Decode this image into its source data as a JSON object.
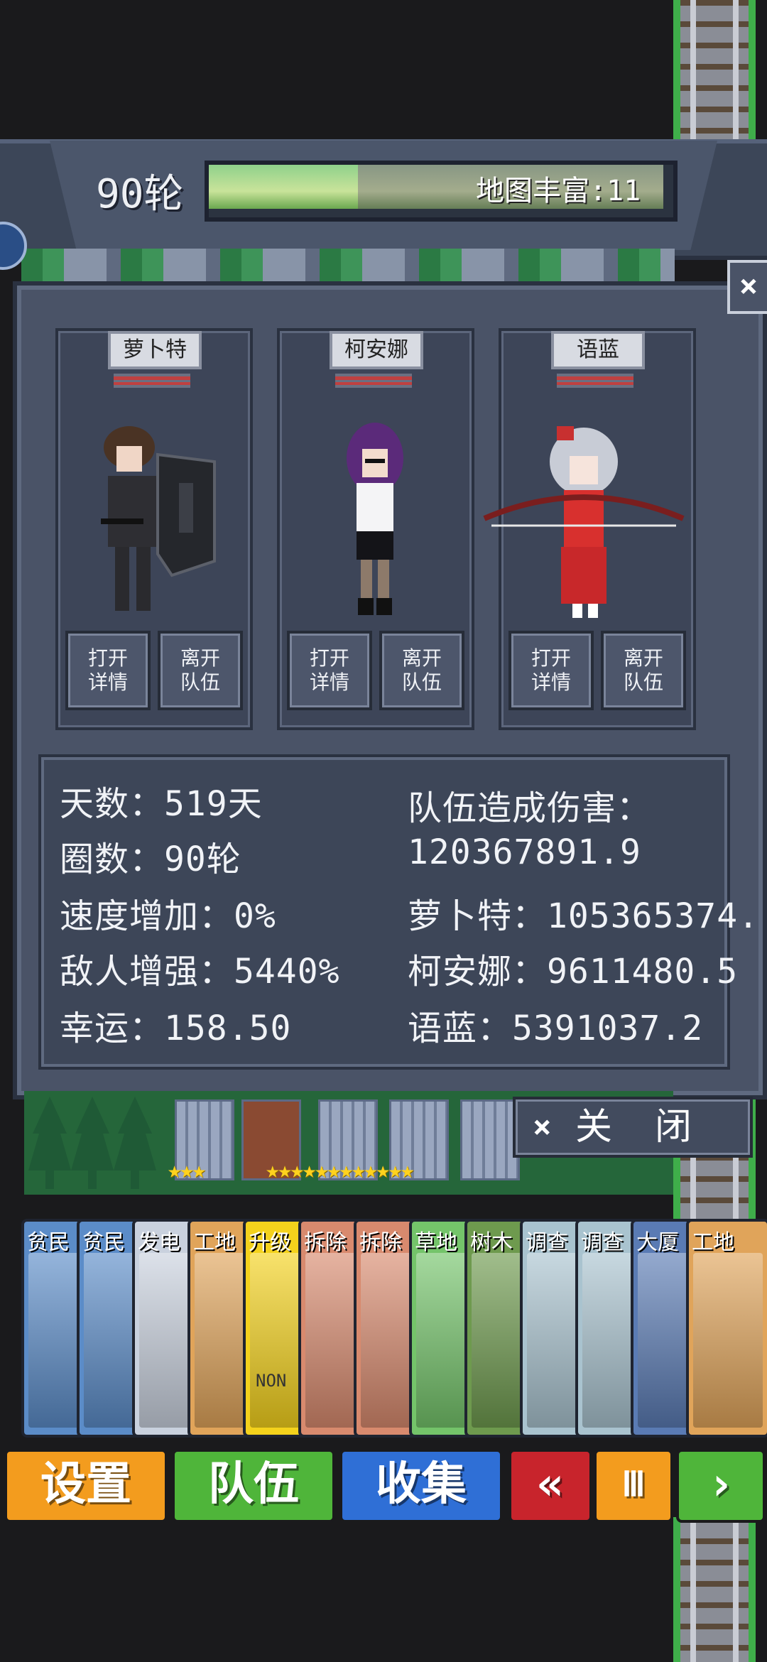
{
  "header": {
    "round": "90轮",
    "map_label": "地图丰富:11"
  },
  "team": [
    {
      "name": "萝卜特",
      "detail": "打开\n详情",
      "leave": "离开\n队伍"
    },
    {
      "name": "柯安娜",
      "detail": "打开\n详情",
      "leave": "离开\n队伍"
    },
    {
      "name": "语蓝",
      "detail": "打开\n详情",
      "leave": "离开\n队伍"
    }
  ],
  "stats": {
    "days": "天数：519天",
    "laps": "圈数：90轮",
    "speed": "速度增加：0%",
    "enemy": "敌人增强：5440%",
    "luck": "幸运：158.50",
    "damage_label": "队伍造成伤害：",
    "damage_total": "120367891.9",
    "dmg_1": "萝卜特：105365374.",
    "dmg_2": "柯安娜：9611480.5",
    "dmg_3": "语蓝：5391037.2"
  },
  "close_button": {
    "x": "×",
    "label": "关闭"
  },
  "cards": [
    {
      "label": "贫民",
      "color": "#5b8cc8"
    },
    {
      "label": "贫民",
      "color": "#5b8cc8"
    },
    {
      "label": "发电",
      "color": "#c9d1de"
    },
    {
      "label": "工地",
      "color": "#e0a45a"
    },
    {
      "label": "升级",
      "color": "#f4d21c"
    },
    {
      "label": "拆除",
      "color": "#d88a6e"
    },
    {
      "label": "拆除",
      "color": "#d88a6e"
    },
    {
      "label": "草地",
      "color": "#74c46a"
    },
    {
      "label": "树木",
      "color": "#6e9a4e"
    },
    {
      "label": "调查",
      "color": "#a9c3cf"
    },
    {
      "label": "调查",
      "color": "#a9c3cf"
    },
    {
      "label": "大厦",
      "color": "#5a7bb4"
    },
    {
      "label": "工地",
      "color": "#e0a45a"
    }
  ],
  "card_inner_text": "NON",
  "buttons": {
    "settings": "设置",
    "team": "队伍",
    "collect": "收集",
    "rewind": "«",
    "pause": "Ⅲ",
    "play": "›"
  },
  "colors": {
    "settings": "#f39c1e",
    "team": "#4fb53a",
    "collect": "#2f6fd6",
    "rewind": "#c8242c",
    "pause": "#f39c1e",
    "play": "#4fb53a"
  }
}
